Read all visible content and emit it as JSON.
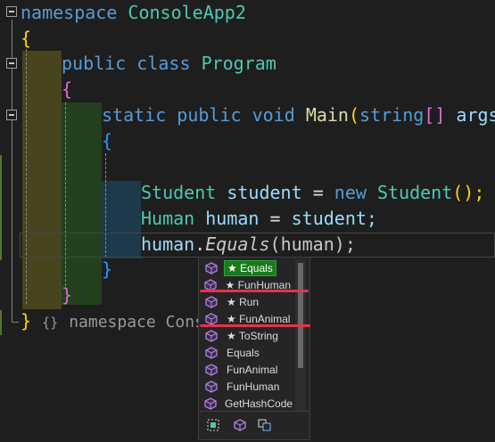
{
  "code": {
    "line1": {
      "kw": "namespace",
      "name": "ConsoleApp2"
    },
    "line2": {
      "brace": "{"
    },
    "line3": {
      "kw1": "public",
      "kw2": "class",
      "type": "Program"
    },
    "line4": {
      "brace": "{"
    },
    "line5": {
      "kw1": "static",
      "kw2": "public",
      "kw3": "void",
      "method": "Main",
      "open": "(",
      "type": "string",
      "arr": "[]",
      "param": "args",
      "close": ")"
    },
    "line6": {
      "brace": "{"
    },
    "line7": {
      "type1": "Student",
      "var": "student",
      "eq": "=",
      "kw": "new",
      "type2": "Student",
      "call": "();"
    },
    "line8": {
      "type": "Human",
      "var": "human",
      "eq": "=",
      "value": "student;"
    },
    "line9": {
      "obj": "human",
      "dot": ".",
      "method": "Equals",
      "open": "(",
      "arg": "human",
      "close": ");"
    },
    "line10": {
      "brace": "}"
    },
    "line11": {
      "brace": "}"
    },
    "line12": {
      "brace": "}",
      "hint_glyph": "{}",
      "hint_text": "namespace Conso"
    }
  },
  "completion": {
    "items": [
      {
        "label": "★ Equals",
        "selected": true
      },
      {
        "label": "★ FunHuman",
        "selected": false
      },
      {
        "label": "★ Run",
        "selected": false
      },
      {
        "label": "★ FunAnimal",
        "selected": false
      },
      {
        "label": "★ ToString",
        "selected": false
      },
      {
        "label": "Equals",
        "selected": false
      },
      {
        "label": "FunAnimal",
        "selected": false
      },
      {
        "label": "FunHuman",
        "selected": false
      },
      {
        "label": "GetHashCode",
        "selected": false
      }
    ],
    "icon": "method-cube-icon",
    "filters": [
      "expand-filter-icon",
      "method-filter-icon",
      "extension-filter-icon"
    ]
  },
  "colors": {
    "keyword": "#569cd6",
    "type": "#4ec9b0",
    "method": "#dcdcaa",
    "selection": "#1a7a1a",
    "annotation": "#e8314a"
  }
}
